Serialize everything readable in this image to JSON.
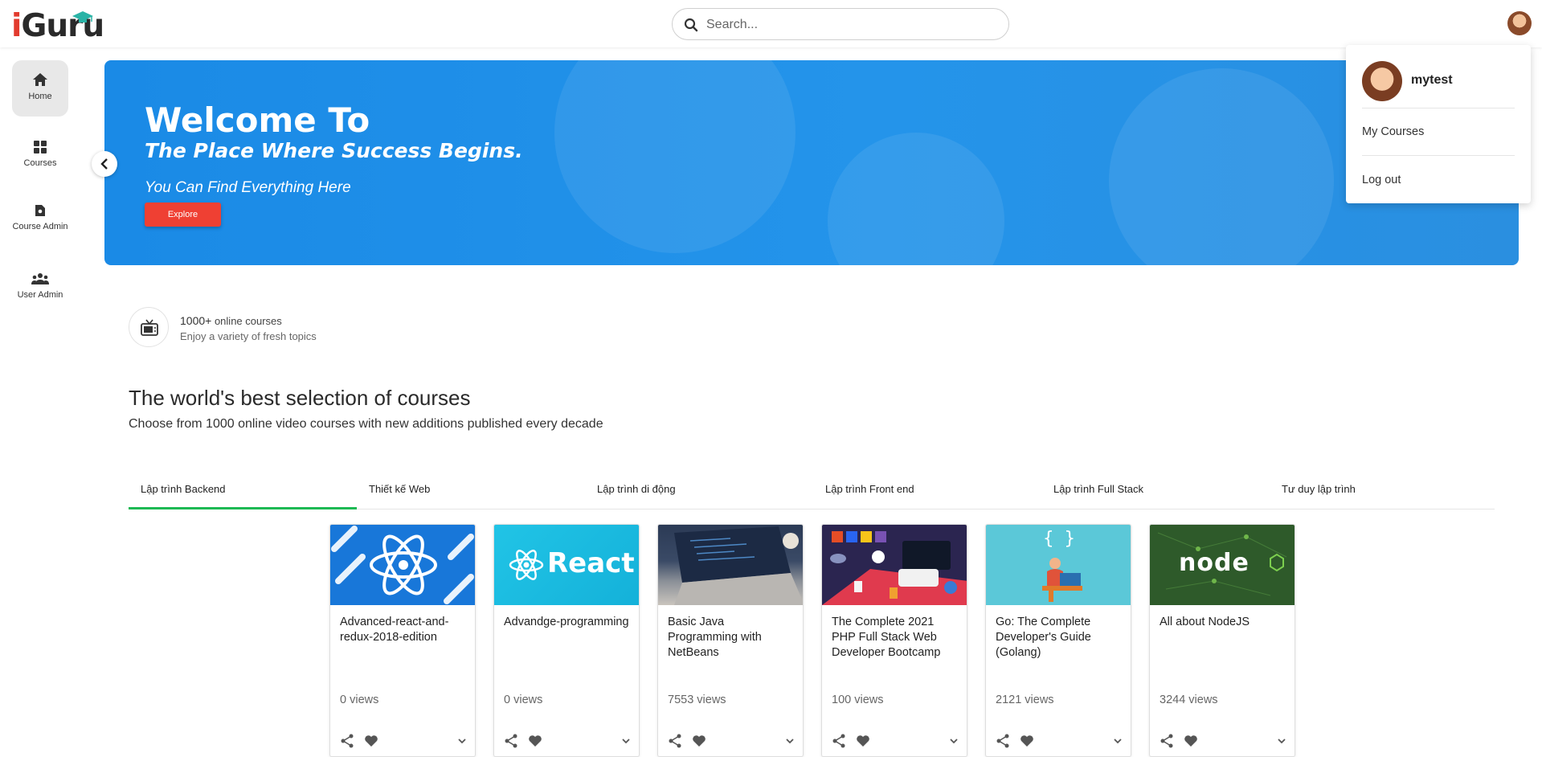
{
  "app": {
    "logo_text": "iGuru",
    "search_placeholder": "Search..."
  },
  "sidebar": {
    "items": [
      {
        "label": "Home",
        "icon": "home-icon"
      },
      {
        "label": "Courses",
        "icon": "grid-icon"
      },
      {
        "label": "Course Admin",
        "icon": "course-admin-icon"
      },
      {
        "label": "User Admin",
        "icon": "user-group-icon"
      }
    ]
  },
  "banner": {
    "heading": "Welcome To",
    "subheading": "The Place Where Success Begins.",
    "tagline": "You Can Find Everything Here",
    "button_label": "Explore",
    "accent_color": "#2494ea",
    "button_color": "#ef4033"
  },
  "stats": {
    "count": "1000+",
    "count_label": "online courses",
    "description": "Enjoy a variety of fresh topics"
  },
  "section": {
    "title": "The world's best selection of courses",
    "subtitle": "Choose from 1000 online video courses with new additions published every decade"
  },
  "tabs": [
    {
      "label": "Lập trình Backend",
      "active": true
    },
    {
      "label": "Thiết kế Web",
      "active": false
    },
    {
      "label": "Lập trình di động",
      "active": false
    },
    {
      "label": "Lập trình Front end",
      "active": false
    },
    {
      "label": "Lập trình Full Stack",
      "active": false
    },
    {
      "label": "Tư duy lập trình",
      "active": false
    }
  ],
  "courses": [
    {
      "title": "Advanced-react-and-redux-2018-edition",
      "views": "0 views"
    },
    {
      "title": "Advandge-programming",
      "views": "0 views"
    },
    {
      "title": "Basic Java Programming with NetBeans",
      "views": "7553 views"
    },
    {
      "title": "The Complete 2021 PHP Full Stack Web Developer Bootcamp",
      "views": "100 views"
    },
    {
      "title": "Go: The Complete Developer's Guide (Golang)",
      "views": "2121 views"
    },
    {
      "title": "All about NodeJS",
      "views": "3244 views"
    }
  ],
  "user_menu": {
    "username": "mytest",
    "items": [
      "My Courses",
      "Log out"
    ]
  },
  "thumb_text": {
    "react": "React",
    "node": "node"
  }
}
